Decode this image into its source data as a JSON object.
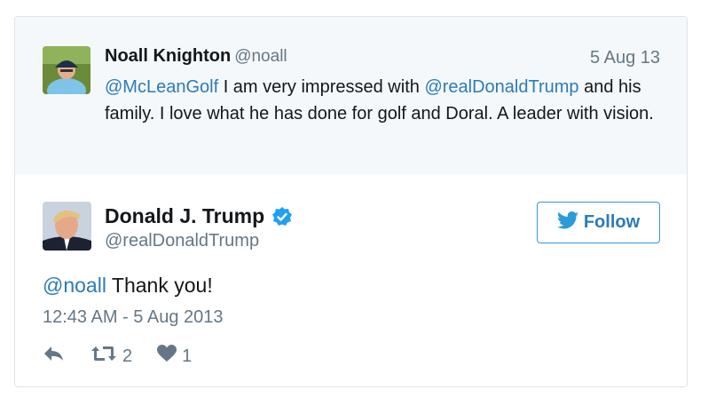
{
  "parent_tweet": {
    "author_name": "Noall Knighton",
    "author_handle": "@noall",
    "date": "5 Aug 13",
    "text_parts": [
      {
        "text": "@McLeanGolf",
        "mention": true
      },
      {
        "text": " I am very impressed with ",
        "mention": false
      },
      {
        "text": "@realDonaldTrump",
        "mention": true
      },
      {
        "text": " and his family. I love what he has done for golf and Doral. A leader with vision.",
        "mention": false
      }
    ]
  },
  "tweet": {
    "author_name": "Donald J. Trump",
    "author_handle": "@realDonaldTrump",
    "verified_icon": "verified-badge-icon",
    "follow_label": "Follow",
    "text_mention": "@noall",
    "text_body": " Thank you!",
    "timestamp": "12:43 AM - 5 Aug 2013",
    "retweet_count": "2",
    "like_count": "1"
  },
  "colors": {
    "link": "#2b7bb9",
    "muted": "#657786",
    "parent_bg": "#f5f8fa",
    "verified": "#1da1f2"
  }
}
